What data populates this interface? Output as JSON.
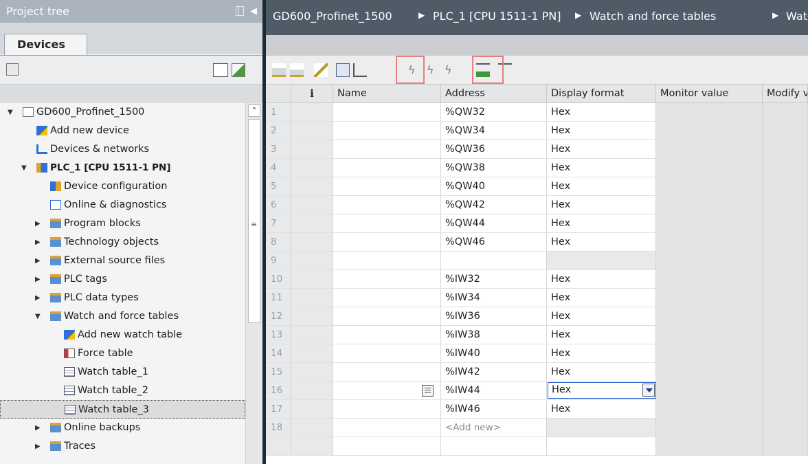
{
  "left_pane": {
    "title": "Project tree",
    "tab": "Devices",
    "tree": [
      {
        "label": "GD600_Profinet_1500",
        "icon": "project-icon",
        "indent": 0,
        "expand": "expanded"
      },
      {
        "label": "Add new device",
        "icon": "add-device-icon",
        "indent": 1,
        "expand": "none"
      },
      {
        "label": "Devices & networks",
        "icon": "network-icon",
        "indent": 1,
        "expand": "none"
      },
      {
        "label": "PLC_1 [CPU 1511-1 PN]",
        "icon": "plc-icon",
        "indent": 1,
        "expand": "expanded",
        "bold": true
      },
      {
        "label": "Device configuration",
        "icon": "device-config-icon",
        "indent": 2,
        "expand": "none"
      },
      {
        "label": "Online & diagnostics",
        "icon": "diagnostics-icon",
        "indent": 2,
        "expand": "none"
      },
      {
        "label": "Program blocks",
        "icon": "folder-icon",
        "indent": 2,
        "expand": "collapsed"
      },
      {
        "label": "Technology objects",
        "icon": "folder-icon",
        "indent": 2,
        "expand": "collapsed"
      },
      {
        "label": "External source files",
        "icon": "folder-icon",
        "indent": 2,
        "expand": "collapsed"
      },
      {
        "label": "PLC tags",
        "icon": "folder-icon",
        "indent": 2,
        "expand": "collapsed"
      },
      {
        "label": "PLC data types",
        "icon": "folder-icon",
        "indent": 2,
        "expand": "collapsed"
      },
      {
        "label": "Watch and force tables",
        "icon": "folder-icon",
        "indent": 2,
        "expand": "expanded"
      },
      {
        "label": "Add new watch table",
        "icon": "add-table-icon",
        "indent": 3,
        "expand": "none"
      },
      {
        "label": "Force table",
        "icon": "force-table-icon",
        "indent": 3,
        "expand": "none"
      },
      {
        "label": "Watch table_1",
        "icon": "watch-table-icon",
        "indent": 3,
        "expand": "none"
      },
      {
        "label": "Watch table_2",
        "icon": "watch-table-icon",
        "indent": 3,
        "expand": "none"
      },
      {
        "label": "Watch table_3",
        "icon": "watch-table-icon",
        "indent": 3,
        "expand": "none",
        "selected": true
      },
      {
        "label": "Online backups",
        "icon": "folder-icon",
        "indent": 2,
        "expand": "collapsed"
      },
      {
        "label": "Traces",
        "icon": "folder-icon",
        "indent": 2,
        "expand": "collapsed"
      }
    ]
  },
  "right_pane": {
    "breadcrumb": [
      "GD600_Profinet_1500",
      "PLC_1 [CPU 1511-1 PN]",
      "Watch and force tables",
      "Watc"
    ],
    "table": {
      "columns": [
        "",
        "i",
        "Name",
        "Address",
        "Display format",
        "Monitor value",
        "Modify v"
      ],
      "rows": [
        {
          "num": "1",
          "address": "%QW32",
          "format": "Hex"
        },
        {
          "num": "2",
          "address": "%QW34",
          "format": "Hex"
        },
        {
          "num": "3",
          "address": "%QW36",
          "format": "Hex"
        },
        {
          "num": "4",
          "address": "%QW38",
          "format": "Hex"
        },
        {
          "num": "5",
          "address": "%QW40",
          "format": "Hex"
        },
        {
          "num": "6",
          "address": "%QW42",
          "format": "Hex"
        },
        {
          "num": "7",
          "address": "%QW44",
          "format": "Hex"
        },
        {
          "num": "8",
          "address": "%QW46",
          "format": "Hex"
        },
        {
          "num": "9",
          "address": "",
          "format": ""
        },
        {
          "num": "10",
          "address": "%IW32",
          "format": "Hex"
        },
        {
          "num": "11",
          "address": "%IW34",
          "format": "Hex"
        },
        {
          "num": "12",
          "address": "%IW36",
          "format": "Hex"
        },
        {
          "num": "13",
          "address": "%IW38",
          "format": "Hex"
        },
        {
          "num": "14",
          "address": "%IW40",
          "format": "Hex"
        },
        {
          "num": "15",
          "address": "%IW42",
          "format": "Hex"
        },
        {
          "num": "16",
          "address": "%IW44",
          "format": "Hex",
          "editing": true
        },
        {
          "num": "17",
          "address": "%IW46",
          "format": "Hex"
        },
        {
          "num": "18",
          "address": "<Add new>",
          "format": ""
        }
      ]
    }
  },
  "colors": {
    "left_title_bg": "#a9b2bd",
    "breadcrumb_bg": "#4f5b67",
    "divider": "#1d2a36",
    "highlight_box": "#e3807d",
    "dropdown_border": "#2b5fd1"
  }
}
